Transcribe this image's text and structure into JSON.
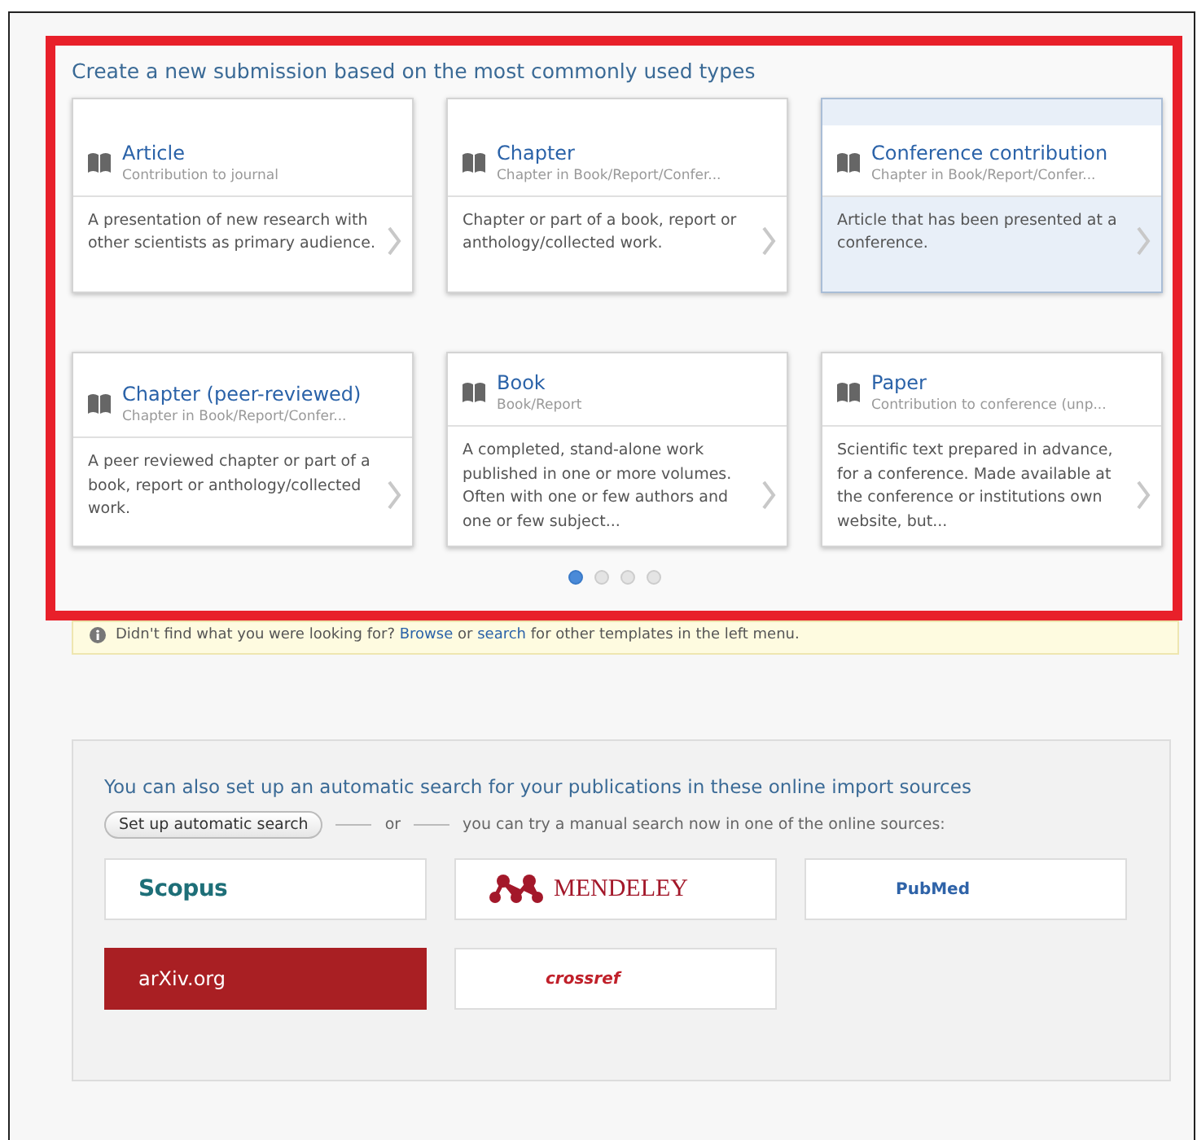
{
  "heading": "Create a new submission based on the most commonly used types",
  "cards": [
    {
      "title": "Article",
      "subtitle": "Contribution to journal",
      "description": "A presentation of new research with other scientists as primary audience.",
      "selected": false
    },
    {
      "title": "Chapter",
      "subtitle": "Chapter in Book/Report/Confer...",
      "description": "Chapter or part of a book, report or anthology/collected work.",
      "selected": false
    },
    {
      "title": "Conference contribution",
      "subtitle": "Chapter in Book/Report/Confer...",
      "description": "Article that has been presented at a conference.",
      "selected": true
    },
    {
      "title": "Chapter (peer-reviewed)",
      "subtitle": "Chapter in Book/Report/Confer...",
      "description": "A peer reviewed chapter or part of a book, report or anthology/collected work.",
      "selected": false
    },
    {
      "title": "Book",
      "subtitle": "Book/Report",
      "description": "A completed, stand-alone work published in one or more volumes. Often with one or few authors and one or few subject...",
      "selected": false
    },
    {
      "title": "Paper",
      "subtitle": "Contribution to conference (unp...",
      "description": "Scientific text prepared in advance, for a conference. Made available at the conference or institutions own website, but...",
      "selected": false
    }
  ],
  "pager": [
    {
      "selected": true
    },
    {
      "selected": false
    },
    {
      "selected": false
    },
    {
      "selected": false
    }
  ],
  "info": [
    {
      "kind": "text",
      "text": "Didn't find what you were looking for?"
    },
    {
      "kind": "link",
      "text": "Browse"
    },
    {
      "kind": "text",
      "text": "or"
    },
    {
      "kind": "link",
      "text": "search"
    },
    {
      "kind": "text",
      "text": "for other templates in the left menu."
    }
  ],
  "import": {
    "heading": "You can also set up an automatic search for your publications in these online import sources",
    "button": "Set up automatic search",
    "or": "or",
    "manual": "you can try a manual search now in one of the online sources:",
    "sources": [
      {
        "kind": "scopus",
        "label": "Scopus"
      },
      {
        "kind": "mendeley",
        "label": "MENDELEY"
      },
      {
        "kind": "pubmed",
        "label": "PubMed"
      },
      {
        "kind": "arxiv",
        "label": "arXiv.org"
      },
      {
        "kind": "crossref",
        "label": "crossref"
      }
    ]
  }
}
